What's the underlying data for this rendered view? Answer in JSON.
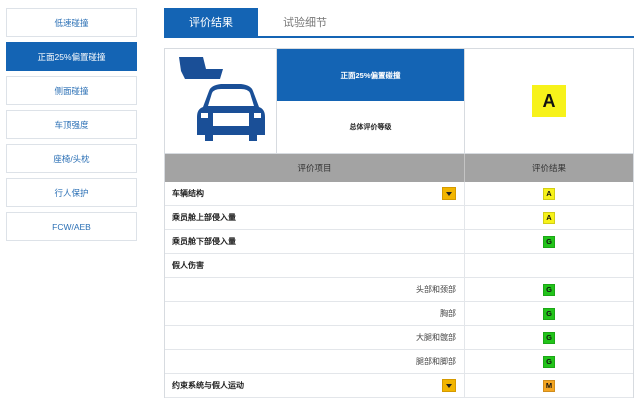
{
  "sidebar": {
    "items": [
      {
        "label": "低速碰撞",
        "active": false
      },
      {
        "label": "正面25%偏置碰撞",
        "active": true
      },
      {
        "label": "侧面碰撞",
        "active": false
      },
      {
        "label": "车顶强度",
        "active": false
      },
      {
        "label": "座椅/头枕",
        "active": false
      },
      {
        "label": "行人保护",
        "active": false
      },
      {
        "label": "FCW/AEB",
        "active": false
      }
    ]
  },
  "tabs": [
    {
      "label": "评价结果",
      "active": true
    },
    {
      "label": "试验细节",
      "active": false
    }
  ],
  "summary": {
    "test_name": "正面25%偏置碰撞",
    "overall_label": "总体评价等级",
    "overall_grade": "A",
    "overall_grade_color": "#f7f21a",
    "illustration_icon": "car-offset-crash-icon"
  },
  "table": {
    "headers": {
      "item": "评价项目",
      "result": "评价结果"
    },
    "rows": [
      {
        "label": "车辆结构",
        "grade": "A",
        "color": "#f7f21a",
        "bold": true,
        "dropdown": true
      },
      {
        "label": "乘员舱上部侵入量",
        "grade": "A",
        "color": "#f7f21a",
        "bold": true,
        "dropdown": false
      },
      {
        "label": "乘员舱下部侵入量",
        "grade": "G",
        "color": "#22c41a",
        "bold": true,
        "dropdown": false
      },
      {
        "label": "假人伤害",
        "grade": "",
        "color": "",
        "bold": true,
        "dropdown": false
      },
      {
        "label": "头部和颈部",
        "grade": "G",
        "color": "#22c41a",
        "bold": false,
        "dropdown": false
      },
      {
        "label": "胸部",
        "grade": "G",
        "color": "#22c41a",
        "bold": false,
        "dropdown": false
      },
      {
        "label": "大腿和髋部",
        "grade": "G",
        "color": "#22c41a",
        "bold": false,
        "dropdown": false
      },
      {
        "label": "腿部和脚部",
        "grade": "G",
        "color": "#22c41a",
        "bold": false,
        "dropdown": false
      },
      {
        "label": "约束系统与假人运动",
        "grade": "M",
        "color": "#f5a623",
        "bold": true,
        "dropdown": true
      }
    ]
  },
  "colors": {
    "accent": "#1464b4",
    "header_gray": "#a3a3a3",
    "dropdown_yellow": "#f2b500"
  }
}
